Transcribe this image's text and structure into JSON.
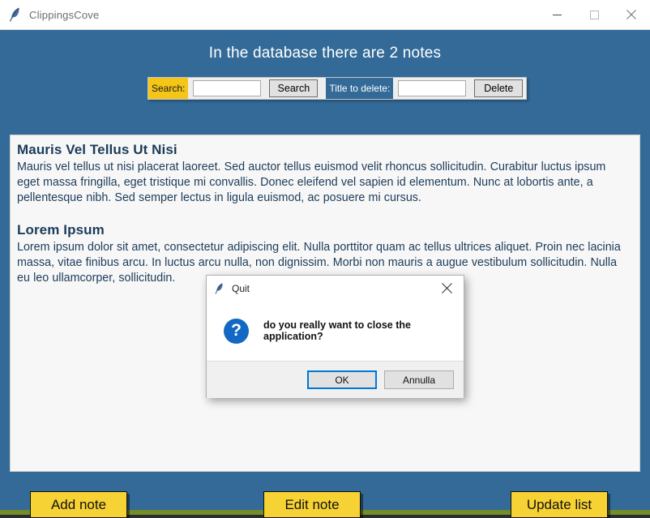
{
  "window": {
    "title": "ClippingsCove",
    "icon": "feather-icon",
    "controls": {
      "minimize": "minimize-icon",
      "maximize": "maximize-icon",
      "close": "close-icon"
    }
  },
  "header": {
    "headline": "In the database there are 2 notes"
  },
  "toolbar": {
    "search_label": "Search:",
    "search_value": "",
    "search_placeholder": "",
    "search_button": "Search",
    "delete_label": "Title to delete:",
    "delete_value": "",
    "delete_placeholder": "",
    "delete_button": "Delete"
  },
  "notes": [
    {
      "title": "Mauris Vel Tellus Ut Nisi",
      "body": "Mauris vel tellus ut nisi placerat laoreet. Sed auctor tellus euismod velit rhoncus sollicitudin. Curabitur luctus ipsum eget massa fringilla, eget tristique mi convallis. Donec eleifend vel sapien id elementum. Nunc at lobortis ante, a pellentesque nibh. Sed semper lectus in ligula euismod, ac posuere mi cursus."
    },
    {
      "title": "Lorem Ipsum",
      "body": "Lorem ipsum dolor sit amet, consectetur adipiscing elit. Nulla porttitor quam ac tellus ultrices aliquet. Proin nec lacinia massa, vitae finibus arcu. In luctus arcu nulla, non dignissim. Morbi non mauris a augue vestibulum sollicitudin. Nulla eu leo ullamcorper, sollicitudin."
    }
  ],
  "actions": {
    "add_note": "Add note",
    "edit_note": "Edit note",
    "update_list": "Update list"
  },
  "dialog": {
    "title": "Quit",
    "icon": "feather-icon",
    "close_icon": "close-icon",
    "question_icon": "question-mark-icon",
    "question_glyph": "?",
    "message": "do you really want to close the application?",
    "ok_label": "OK",
    "cancel_label": "Annulla"
  },
  "colors": {
    "window_background": "#336a98",
    "accent_yellow": "#f7d234",
    "label_yellow": "#f5c518",
    "note_text": "#1b3c5a",
    "dialog_accent": "#0078d7",
    "question_icon": "#1268c3"
  }
}
